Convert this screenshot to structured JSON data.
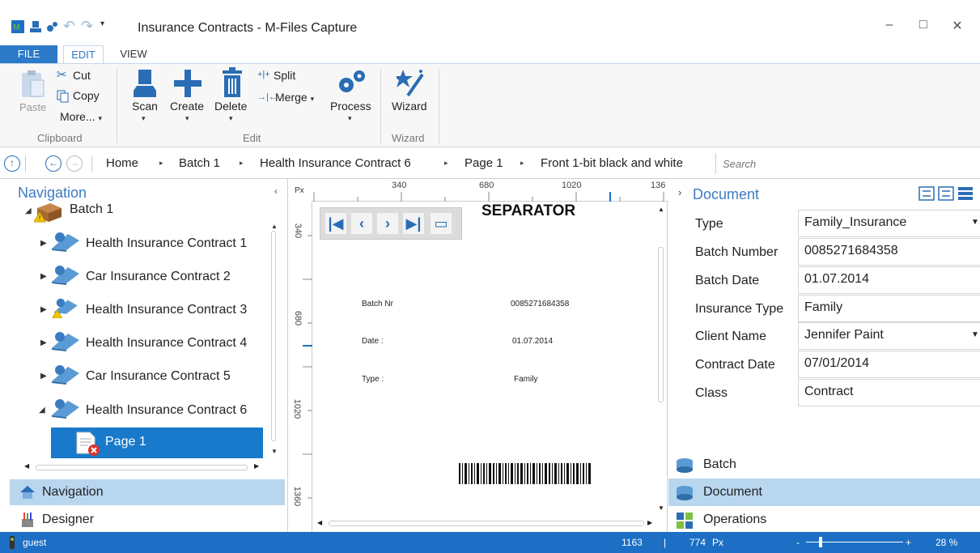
{
  "window": {
    "title": "Insurance Contracts - M-Files Capture",
    "minimize": "–",
    "maximize": "□",
    "close": "✕"
  },
  "tabs": {
    "file": "FILE",
    "edit": "EDIT",
    "view": "VIEW"
  },
  "ribbon": {
    "paste": "Paste",
    "cut": "Cut",
    "copy": "Copy",
    "more": "More...",
    "clipboard_group": "Clipboard",
    "scan": "Scan",
    "create": "Create",
    "delete": "Delete",
    "split": "Split",
    "merge": "Merge",
    "process": "Process",
    "edit_group": "Edit",
    "wizard": "Wizard",
    "wizard_group": "Wizard"
  },
  "breadcrumb": {
    "items": [
      "Home",
      "Batch 1",
      "Health Insurance Contract 6",
      "Page 1",
      "Front 1-bit black and white"
    ],
    "search_placeholder": "Search"
  },
  "navigation": {
    "title": "Navigation",
    "batch": "Batch 1",
    "items": [
      "Health Insurance Contract 1",
      "Car Insurance Contract 2",
      "Health Insurance Contract 3",
      "Health Insurance Contract 4",
      "Car Insurance Contract 5",
      "Health Insurance Contract 6"
    ],
    "selected_page": "Page 1",
    "bottom_tabs": [
      "Navigation",
      "Designer"
    ]
  },
  "viewer": {
    "ruler_unit": "Px",
    "ruler_top": [
      "340",
      "680",
      "1020",
      "136"
    ],
    "ruler_left": [
      "340",
      "680",
      "1020",
      "1360"
    ],
    "page": {
      "heading": "SEPARATOR",
      "batch_nr_label": "Batch Nr",
      "batch_nr_value": "0085271684358",
      "date_label": "Date :",
      "date_value": "01.07.2014",
      "type_label": "Type :",
      "type_value": "Family"
    }
  },
  "document": {
    "title": "Document",
    "properties": [
      {
        "label": "Type",
        "value": "Family_Insurance",
        "dropdown": true
      },
      {
        "label": "Batch Number",
        "value": "0085271684358",
        "dropdown": false
      },
      {
        "label": "Batch Date",
        "value": "01.07.2014",
        "dropdown": false
      },
      {
        "label": "Insurance Type",
        "value": "Family",
        "dropdown": false
      },
      {
        "label": "Client Name",
        "value": "Jennifer Paint",
        "dropdown": true
      },
      {
        "label": "Contract Date",
        "value": "07/01/2014",
        "dropdown": false
      },
      {
        "label": "Class",
        "value": "Contract",
        "dropdown": false
      }
    ],
    "bottom_tabs": [
      "Batch",
      "Document",
      "Operations"
    ]
  },
  "status": {
    "user": "guest",
    "x": "1163",
    "separator": "|",
    "y": "774",
    "unit": "Px",
    "zoom_minus": "-",
    "zoom_plus": "+",
    "zoom": "28 %"
  },
  "colors": {
    "accent": "#1c6fc4",
    "selected_tab": "#b9d6ef",
    "nav_selected": "#1979ca"
  }
}
